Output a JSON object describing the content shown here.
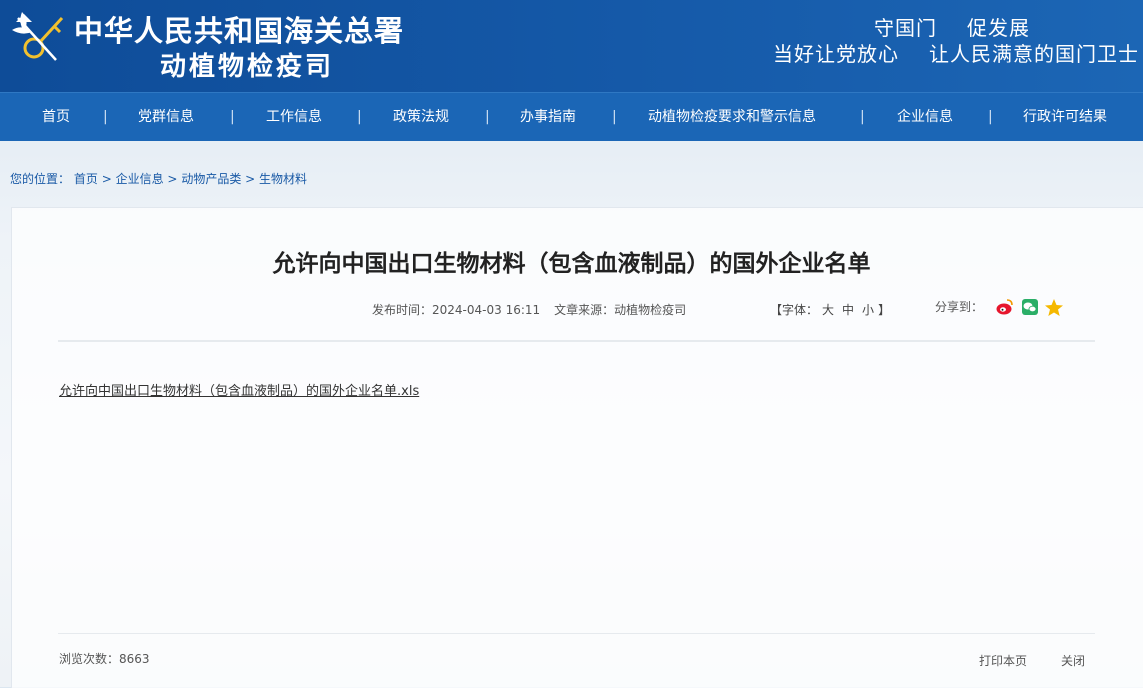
{
  "header": {
    "site_name_line1": "中华人民共和国海关总署",
    "site_name_line2": "动植物检疫司",
    "slogan_left": "守国门",
    "slogan_right": "促发展",
    "slogan_line2_left": "当好让党放心",
    "slogan_line2_right": "让人民满意的国门卫士"
  },
  "nav": {
    "items": [
      "首页",
      "党群信息",
      "工作信息",
      "政策法规",
      "办事指南",
      "动植物检疫要求和警示信息",
      "企业信息",
      "行政许可结果"
    ],
    "separator": "|"
  },
  "breadcrumb": {
    "label": "您的位置：",
    "items": [
      "首页",
      "企业信息",
      "动物产品类",
      "生物材料"
    ],
    "separator": ">"
  },
  "article": {
    "title": "允许向中国出口生物材料（包含血液制品）的国外企业名单",
    "publish_label": "发布时间：",
    "publish_time": "2024-04-03 16:11",
    "source_label": "文章来源：",
    "source": "动植物检疫司",
    "font_prefix": "【字体：",
    "font_large": "大",
    "font_medium": "中",
    "font_small": "小",
    "font_suffix": "】",
    "share_label": "分享到：",
    "share_icons": [
      "weibo-icon",
      "wechat-icon",
      "favorite-star-icon"
    ],
    "attachment": "允许向中国出口生物材料（包含血液制品）的国外企业名单.xls"
  },
  "footer": {
    "views_label": "浏览次数：",
    "views": "8663",
    "print": "打印本页",
    "close": "关闭"
  },
  "colors": {
    "header_bg": "#1559a8",
    "nav_bg": "#1b66b6",
    "link": "#1a5aa6"
  }
}
